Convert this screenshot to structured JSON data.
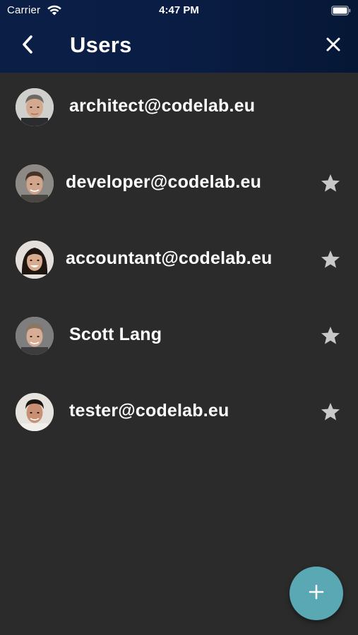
{
  "status_bar": {
    "carrier": "Carrier",
    "time": "4:47 PM",
    "wifi_icon": "wifi-icon",
    "battery_icon": "battery-icon"
  },
  "nav": {
    "title": "Users",
    "back_icon": "chevron-left-icon",
    "close_icon": "close-icon",
    "background_colors": [
      "#0b1f46",
      "#061735"
    ]
  },
  "users": [
    {
      "name": "architect@codelab.eu",
      "avatar": "avatar-man-gray-hair",
      "starred": false
    },
    {
      "name": "developer@codelab.eu",
      "avatar": "avatar-man-brown-hair",
      "starred": true
    },
    {
      "name": "accountant@codelab.eu",
      "avatar": "avatar-woman-dark-hair",
      "starred": true
    },
    {
      "name": "Scott Lang",
      "avatar": "avatar-man-light-hair",
      "starred": true
    },
    {
      "name": "tester@codelab.eu",
      "avatar": "avatar-man-dark-hair",
      "starred": true
    }
  ],
  "star_icon": "star-icon",
  "star_color": "#c8c8c8",
  "fab": {
    "icon": "plus-icon",
    "color": "#5aa8b3"
  },
  "background_color": "#2b2b2b"
}
